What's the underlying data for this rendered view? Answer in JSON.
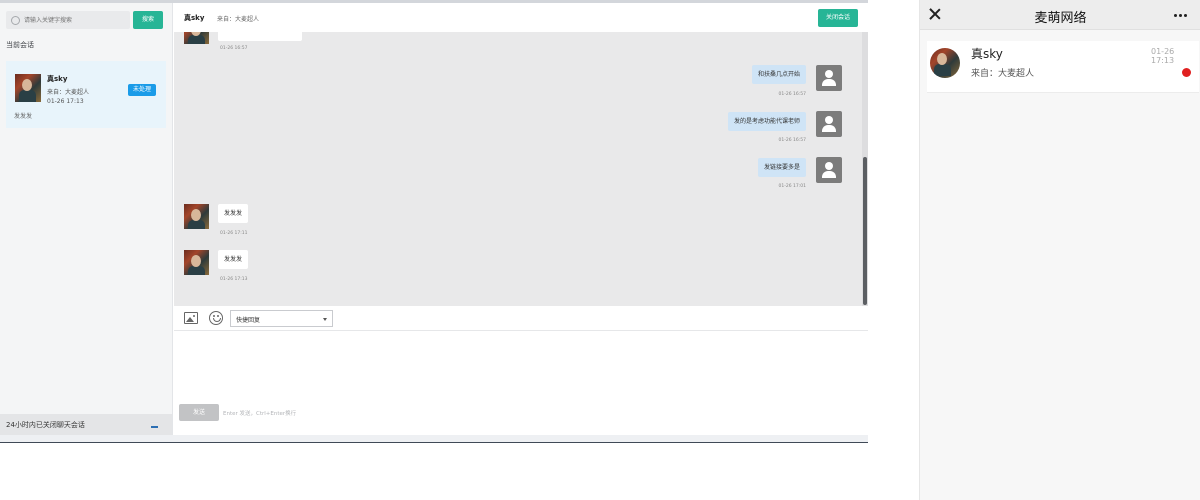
{
  "console": {
    "search": {
      "placeholder": "请输入关键字搜索",
      "button": "搜索"
    },
    "current_sessions_title": "当前会话",
    "session": {
      "name": "真sky",
      "source": "来自：大麦超人",
      "time": "01-26 17:13",
      "preview": "发发发",
      "status_button": "未处理"
    },
    "closed_sessions_label": "24小时内已关闭聊天会话",
    "header": {
      "name": "真sky",
      "source": "来自：大麦超人",
      "close_button": "关闭会话"
    },
    "messages": [
      {
        "side": "in",
        "text": "",
        "time": "01-26 16:57"
      },
      {
        "side": "out",
        "text": "和扶桑几点开始",
        "time": "01-26 16:57"
      },
      {
        "side": "out",
        "text": "发的是考虑功能代课老师",
        "time": "01-26 16:57"
      },
      {
        "side": "out",
        "text": "发链接要多是",
        "time": "01-26 17:01"
      },
      {
        "side": "in",
        "text": "发发发",
        "time": "01-26 17:11"
      },
      {
        "side": "in",
        "text": "发发发",
        "time": "01-26 17:13"
      }
    ],
    "toolbar": {
      "quick_reply": "快捷回复"
    },
    "compose": {
      "send_button": "发送",
      "hint": "Enter 发送，Ctrl+Enter换行"
    }
  },
  "mobile": {
    "title": "麦萌网络",
    "item": {
      "name": "真sky",
      "source": "来自：大麦超人",
      "time": "01-26 17:13",
      "unread": true
    }
  },
  "icons": {
    "search": "search-icon",
    "image": "image-icon",
    "emoji": "emoji-icon",
    "close": "close-icon",
    "more": "more-icon",
    "user_avatar": "user-avatar-icon"
  },
  "colors": {
    "accent_green": "#27b596",
    "status_blue": "#1a9be8",
    "unread_red": "#e02020",
    "outgoing_bubble": "#cfe4f6",
    "chat_background": "#e9e9ea"
  }
}
